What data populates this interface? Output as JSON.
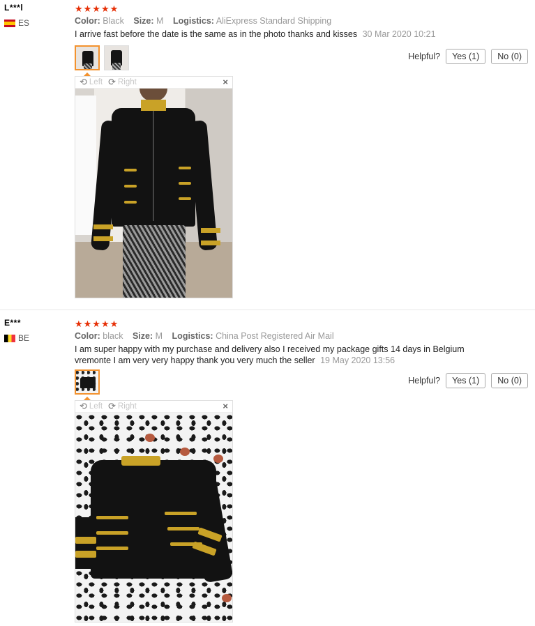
{
  "reviews": [
    {
      "user": "L***l",
      "country": "ES",
      "stars": "★★★★★",
      "color_label": "Color:",
      "color_value": "Black",
      "size_label": "Size:",
      "size_value": "M",
      "logistics_label": "Logistics:",
      "logistics_value": "AliExpress Standard Shipping",
      "text": "I arrive fast before the date is the same as in the photo thanks and kisses",
      "date": "30 Mar 2020 10:21",
      "helpful_label": "Helpful?",
      "yes_label": "Yes (1)",
      "no_label": "No (0)",
      "viewer": {
        "left_label": "Left",
        "right_label": "Right",
        "close": "×"
      }
    },
    {
      "user": "E***",
      "country": "BE",
      "stars": "★★★★★",
      "color_label": "Color:",
      "color_value": "black",
      "size_label": "Size:",
      "size_value": "M",
      "logistics_label": "Logistics:",
      "logistics_value": "China Post Registered Air Mail",
      "text": "I am super happy with my purchase and delivery also I received my package gifts 14 days in Belgium vremonte I am very very happy thank you very much the seller",
      "date": "19 May 2020 13:56",
      "helpful_label": "Helpful?",
      "yes_label": "Yes (1)",
      "no_label": "No (0)",
      "viewer": {
        "left_label": "Left",
        "right_label": "Right",
        "close": "×"
      }
    }
  ],
  "icons": {
    "rotate_left": "⟲",
    "rotate_right": "⟳"
  },
  "colors": {
    "star": "#e62e04",
    "active_thumb_border": "#f3922e"
  }
}
